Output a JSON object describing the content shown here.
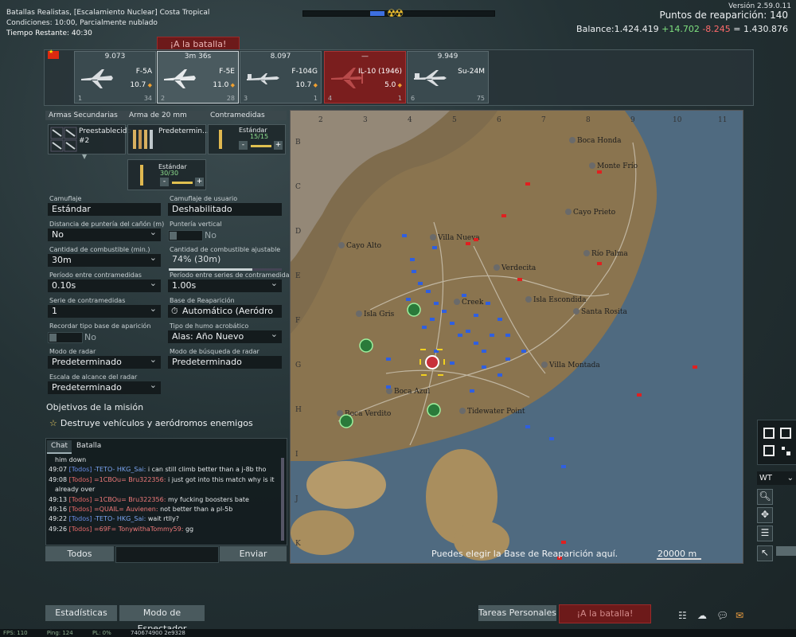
{
  "mission": {
    "title": "Batallas Realistas, [Escalamiento Nuclear] Costa Tropical",
    "conditions": "Condiciones: 10:00, Parcialmente nublado",
    "time_left": "Tiempo Restante: 40:30"
  },
  "top_right": {
    "version": "Versión 2.59.0.11",
    "respawn_points": "Puntos de reaparición: 140",
    "balance_label": "Balance:",
    "balance_main": "1.424.419",
    "balance_plus": "+14.702",
    "balance_minus": "-8.245",
    "balance_total": "= 1.430.876"
  },
  "battle_button": "¡A la batalla!",
  "vehicles": [
    {
      "cost": "9.073",
      "name": "F-5A",
      "br": "10.7",
      "num": "1",
      "rp": "34",
      "state": "normal"
    },
    {
      "cost": "3m 36s",
      "name": "F-5E",
      "br": "11.0",
      "num": "2",
      "rp": "28",
      "state": "selected"
    },
    {
      "cost": "8.097",
      "name": "F-104G",
      "br": "10.7",
      "num": "3",
      "rp": "1",
      "state": "normal"
    },
    {
      "cost": "—",
      "name": "IL-10 (1946)",
      "br": "5.0",
      "num": "4",
      "rp": "1",
      "state": "locked"
    },
    {
      "cost": "9.949",
      "name": "Su-24M",
      "br": "",
      "num": "6",
      "rp": "75",
      "state": "normal"
    }
  ],
  "loadout": {
    "secondary_header": "Armas Secundarias",
    "gun_header": "Arma de 20 mm",
    "counter_header": "Contramedidas",
    "secondary_value": "Preestablecido",
    "secondary_sub": "#2",
    "gun_value": "Predetermin...",
    "gun_ammo_label": "Estándar",
    "gun_ammo_count": "30/30",
    "counter_label": "Estándar",
    "counter_count": "15/15"
  },
  "settings": {
    "camo_label": "Camuflaje",
    "camo_value": "Estándar",
    "user_camo_label": "Camuflaje de usuario",
    "user_camo_value": "Deshabilitado",
    "gun_distance_label": "Distancia de puntería del cañón (m)",
    "gun_distance_value": "No",
    "vertical_label": "Puntería vertical",
    "vertical_value": "No",
    "fuel_label": "Cantidad de combustible (min.)",
    "fuel_value": "30m",
    "fuel_adj_label": "Cantidad de combustible ajustable",
    "fuel_adj_value": "74% (30m)",
    "fuel_adj_fraction": 0.74,
    "cm_period_label": "Período entre contramedidas",
    "cm_period_value": "0.10s",
    "cm_series_period_label": "Período entre series de contramedidas",
    "cm_series_period_value": "1.00s",
    "cm_series_label": "Serie de contramedidas",
    "cm_series_value": "1",
    "respawn_base_label": "Base de Reaparición",
    "respawn_base_value": "Automático (Aeródro",
    "remember_base_label": "Recordar tipo base de aparición",
    "remember_base_value": "No",
    "smoke_label": "Tipo de humo acrobático",
    "smoke_value": "Alas: Año Nuevo",
    "radar_mode_label": "Modo de radar",
    "radar_mode_value": "Predeterminado",
    "radar_search_label": "Modo de búsqueda de radar",
    "radar_search_value": "Predeterminado",
    "radar_scale_label": "Escala de alcance del radar",
    "radar_scale_value": "Predeterminado"
  },
  "objectives": {
    "title": "Objetivos de la misión",
    "item": "Destruye vehículos y aeródromos enemigos"
  },
  "chat": {
    "tab_chat": "Chat",
    "tab_battle": "Batalla",
    "lines": [
      {
        "time": "",
        "team": "",
        "player": "",
        "msg": "him down",
        "side": "blue"
      },
      {
        "time": "49:07",
        "team": "[Todos]",
        "player": "-TETO- HKG_Sai:",
        "msg": "i can still climb better than a j-8b tho",
        "side": "blue"
      },
      {
        "time": "49:08",
        "team": "[Todos]",
        "player": "=1CBOu= Bru322356:",
        "msg": "i just got into this match why is it",
        "side": "red"
      },
      {
        "time": "",
        "team": "",
        "player": "",
        "msg": "already over",
        "side": "red"
      },
      {
        "time": "49:13",
        "team": "[Todos]",
        "player": "=1CBOu= Bru322356:",
        "msg": "my fucking boosters bate",
        "side": "red"
      },
      {
        "time": "49:16",
        "team": "[Todos]",
        "player": "=QUAIL= Auvienen:",
        "msg": "not better than a pl-5b",
        "side": "red"
      },
      {
        "time": "49:22",
        "team": "[Todos]",
        "player": "-TETO- HKG_Sai:",
        "msg": "wait rtlly?",
        "side": "blue"
      },
      {
        "time": "49:26",
        "team": "[Todos]",
        "player": "=69F= TonywithaTommy59:",
        "msg": "gg",
        "side": "red"
      }
    ],
    "mode": "Todos",
    "send": "Enviar"
  },
  "map": {
    "col_labels": [
      "2",
      "3",
      "4",
      "5",
      "6",
      "7",
      "8",
      "9",
      "10",
      "11"
    ],
    "row_labels": [
      "B",
      "C",
      "D",
      "E",
      "F",
      "G",
      "H",
      "I",
      "J",
      "K"
    ],
    "places": [
      {
        "name": "Boca Honda"
      },
      {
        "name": "Monte Frío"
      },
      {
        "name": "Cayo Prieto"
      },
      {
        "name": "Cayo Alto"
      },
      {
        "name": "Villa Nueva"
      },
      {
        "name": "Río Palma"
      },
      {
        "name": "Verdecita"
      },
      {
        "name": "Isla Escondida"
      },
      {
        "name": "Santa Rosita"
      },
      {
        "name": "Isla Gris"
      },
      {
        "name": "Creek"
      },
      {
        "name": "Villa Montada"
      },
      {
        "name": "Boca Azul"
      },
      {
        "name": "Boca Verdito"
      },
      {
        "name": "Tidewater Point"
      }
    ],
    "hint": "Puedes elegir la Base de Reaparición aquí.",
    "scale": "20000 m"
  },
  "tools": {
    "language": "WT"
  },
  "bottom": {
    "stats": "Estadísticas",
    "spectator": "Modo de Espectador",
    "tasks": "Tareas Personales",
    "battle": "¡A la batalla!"
  },
  "status": {
    "fps": "FPS: 110",
    "ping": "Ping: 124",
    "pl": "PL: 0%",
    "id": "740674900 2e9328"
  },
  "colors": {
    "ally": "#2f5fe0",
    "enemy": "#e02020",
    "sea": "#4e6a82",
    "land": "#8c7650",
    "battle_button": "#6d1a1a"
  }
}
